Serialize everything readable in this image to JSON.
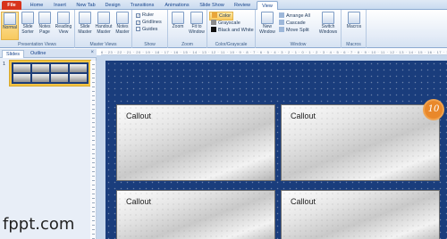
{
  "tabs": [
    {
      "label": "File"
    },
    {
      "label": "Home"
    },
    {
      "label": "Insert"
    },
    {
      "label": "New Tab"
    },
    {
      "label": "Design"
    },
    {
      "label": "Transitions"
    },
    {
      "label": "Animations"
    },
    {
      "label": "Slide Show"
    },
    {
      "label": "Review"
    },
    {
      "label": "View"
    }
  ],
  "ribbon": {
    "presentation_views": {
      "label": "Presentation Views",
      "normal": "Normal",
      "slide_sorter": "Slide Sorter",
      "notes_page": "Notes Page",
      "reading_view": "Reading View"
    },
    "master_views": {
      "label": "Master Views",
      "slide_master": "Slide Master",
      "handout_master": "Handout Master",
      "notes_master": "Notes Master"
    },
    "show": {
      "label": "Show",
      "ruler": "Ruler",
      "gridlines": "Gridlines",
      "guides": "Guides"
    },
    "zoom": {
      "label": "Zoom",
      "zoom": "Zoom",
      "fit_to_window": "Fit to Window"
    },
    "color_grayscale": {
      "label": "Color/Grayscale",
      "color": "Color",
      "grayscale": "Grayscale",
      "black_and_white": "Black and White"
    },
    "window": {
      "label": "Window",
      "new_window": "New Window",
      "arrange_all": "Arrange All",
      "cascade": "Cascade",
      "move_split": "Move Split",
      "switch_windows": "Switch Windows"
    },
    "macros": {
      "label": "Macros",
      "macros": "Macros"
    }
  },
  "pane": {
    "tab_slides": "Slides",
    "tab_outline": "Outline",
    "close": "×",
    "slide_number": "1"
  },
  "ruler_text": "6 · 23 · 22 · 21 · 20 · 19 · 18 · 17 · 16 · 15 · 14 · 13 · 12 · 11 · 10 · 9 · 8 · 7 · 6 · 5 · 4 · 3 · 2 · 1 · 0 · 1 · 2 · 3 · 4 · 5 · 6 · 7 · 8 · 9 · 10 · 11 · 12 · 13 · 14 · 15 · 16 · 17 · 18 · 19 · 20",
  "slide": {
    "callouts": [
      {
        "text": "Callout"
      },
      {
        "text": "Callout"
      },
      {
        "text": "Callout"
      },
      {
        "text": "Callout"
      }
    ],
    "badge": "10"
  },
  "watermark": "fppt.com",
  "colors": {
    "slide_bg": "#1a3d7c",
    "file_tab": "#d7331c",
    "badge": "#e9882a"
  }
}
